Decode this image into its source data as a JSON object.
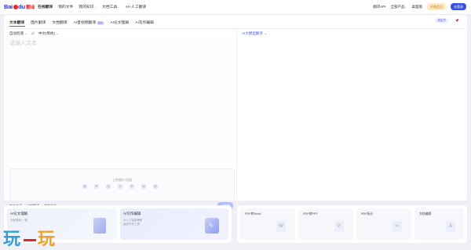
{
  "brand": {
    "bai": "Bai",
    "du": "du",
    "fanyi": "翻译"
  },
  "nav": {
    "items": [
      {
        "label": "在线翻译",
        "active": true,
        "dropdown": false
      },
      {
        "label": "我的文件",
        "active": false,
        "dropdown": false
      },
      {
        "label": "我的知识",
        "active": false,
        "dropdown": true
      },
      {
        "label": "文档工具",
        "active": false,
        "dropdown": true
      },
      {
        "label": "AI+人工翻译",
        "active": false,
        "dropdown": false
      }
    ]
  },
  "right_nav": {
    "items": [
      {
        "label": "翻译API"
      },
      {
        "label": "全部产品",
        "dropdown": true
      },
      {
        "label": "桌面版"
      }
    ],
    "vip_label": "开通会员",
    "login_label": "去登录"
  },
  "tabs": {
    "items": [
      {
        "label": "文本翻译",
        "active": true
      },
      {
        "label": "图片翻译"
      },
      {
        "label": "文档翻译"
      },
      {
        "label": "AI音视频翻译",
        "badge": "限时"
      },
      {
        "label": "AI论文理解"
      },
      {
        "label": "AI写作编辑"
      }
    ],
    "pill_label": "领会员"
  },
  "source": {
    "lang": "自动检测",
    "target": "中文(简体)",
    "placeholder": "请输入文本",
    "upload_text": "上传图片/文档",
    "file_icons": [
      "W",
      "P",
      "X",
      "T",
      "P",
      "W",
      "M"
    ],
    "bottom_items": [
      "专有名词",
      "个性翻译",
      "润色优化"
    ],
    "translate_label": "AI翻译"
  },
  "target": {
    "lang": "AI大模型翻译"
  },
  "cards": {
    "left": [
      {
        "title": "AI论文理解",
        "line1": "文献速读,一键",
        "line2": ""
      },
      {
        "title": "AI写作编辑",
        "line1": "AI人工智能辅助",
        "line2": "高效写作工具"
      }
    ],
    "right": [
      {
        "title": "PDF转Word",
        "icon": "W"
      },
      {
        "title": "PDF转PPT",
        "icon": "P"
      },
      {
        "title": "PDF拆分",
        "icon": "✂"
      },
      {
        "title": "文档编辑",
        "icon": "A"
      }
    ]
  },
  "watermark": {
    "a": "玩",
    "b": "玩"
  }
}
